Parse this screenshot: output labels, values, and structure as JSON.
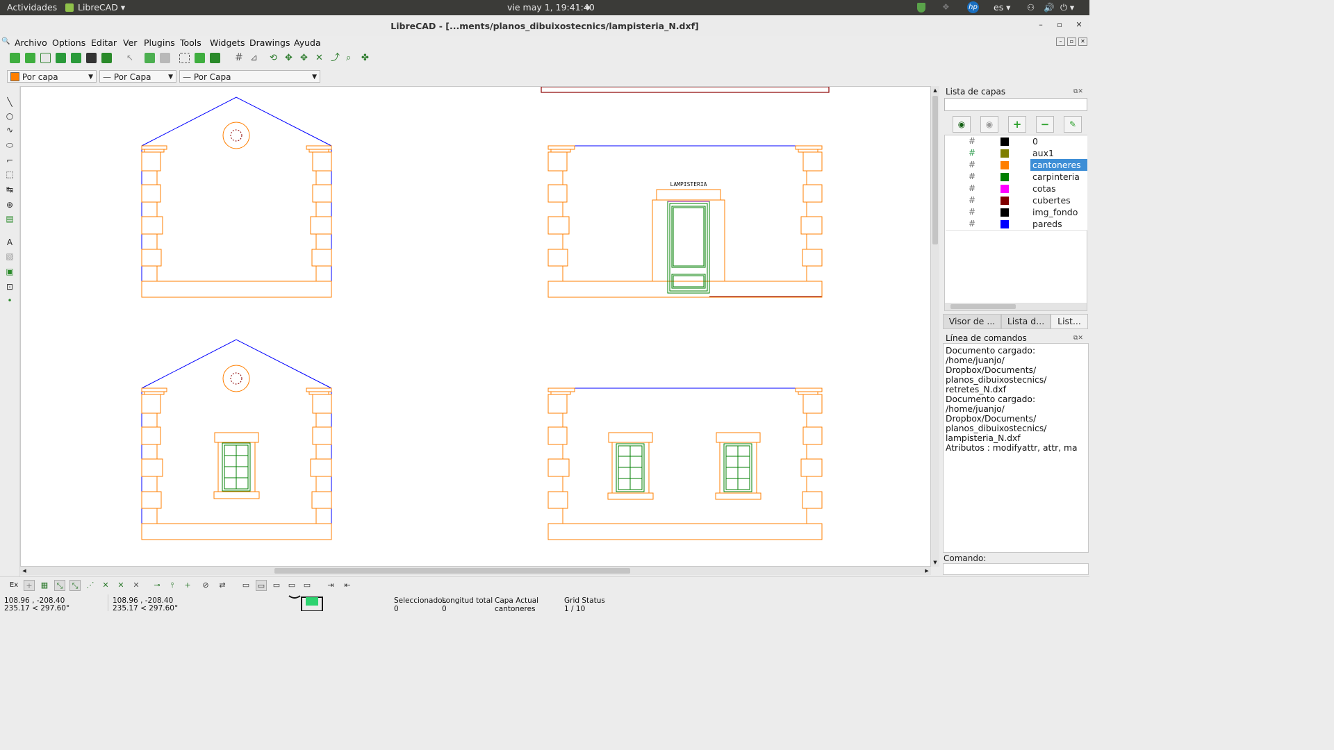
{
  "topbar": {
    "activities": "Actividades",
    "app": "LibreCAD",
    "clock": "vie may  1, 19:41:40",
    "lang": "es"
  },
  "window": {
    "title": "LibreCAD - [...ments/planos_dibuixostecnics/lampisteria_N.dxf]"
  },
  "menu": [
    "Archivo",
    "Options",
    "Editar",
    "Ver",
    "Plugins",
    "Tools",
    "Widgets",
    "Drawings",
    "Ayuda"
  ],
  "pen": {
    "color": "Por capa",
    "linetype": "Por Capa",
    "width": "Por Capa"
  },
  "drawing": {
    "label": "LAMPISTERIA"
  },
  "layers": {
    "title": "Lista de capas",
    "items": [
      {
        "name": "0",
        "color": "#000000"
      },
      {
        "name": "aux1",
        "color": "#7f7f00"
      },
      {
        "name": "cantoneres",
        "color": "#ff7f00",
        "selected": true
      },
      {
        "name": "carpinteria",
        "color": "#007f00"
      },
      {
        "name": "cotas",
        "color": "#ff00ff"
      },
      {
        "name": "cubertes",
        "color": "#7f0000"
      },
      {
        "name": "img_fondo",
        "color": "#000000"
      },
      {
        "name": "pareds",
        "color": "#0000ff"
      }
    ]
  },
  "tabs": [
    "Visor de ...",
    "Lista d...",
    "List..."
  ],
  "command": {
    "title": "Línea de comandos",
    "lines": [
      "Documento cargado: /home/juanjo/",
      "Dropbox/Documents/",
      "planos_dibuixostecnics/",
      "retretes_N.dxf",
      "Documento cargado: /home/juanjo/",
      "Dropbox/Documents/",
      "planos_dibuixostecnics/",
      "lampisteria_N.dxf",
      "Atributos : modifyattr, attr, ma"
    ],
    "prompt": "Comando:"
  },
  "snap": {
    "ex": "Ex"
  },
  "status": {
    "abs1": "108.96 , -208.40",
    "abs2": "235.17 < 297.60°",
    "rel1": "108.96 , -208.40",
    "rel2": "235.17 < 297.60°",
    "sel_label": "Seleccionados",
    "sel_value": "0",
    "len_label": "Longitud total",
    "len_value": "0",
    "layer_label": "Capa Actual",
    "layer_value": "cantoneres",
    "grid_label": "Grid Status",
    "grid_value": "1 / 10"
  }
}
